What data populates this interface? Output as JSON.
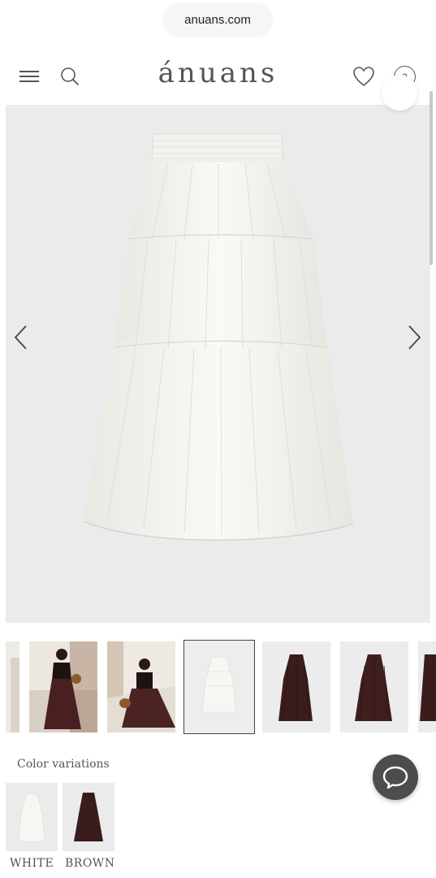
{
  "browser": {
    "url": "anuans.com"
  },
  "header": {
    "logo": "ánuans",
    "cart_count": "0",
    "menu_icon": "hamburger-icon",
    "search_icon": "search-icon",
    "wishlist_icon": "heart-icon"
  },
  "gallery": {
    "main_image": "white-tiered-skirt-photo",
    "prev_icon": "chevron-left-icon",
    "next_icon": "chevron-right-icon",
    "thumbnails": [
      {
        "image": "partial-thumbnail-photo"
      },
      {
        "image": "model-brown-skirt-photo-1"
      },
      {
        "image": "model-brown-skirt-photo-2"
      },
      {
        "image": "white-skirt-flat-photo",
        "selected": true
      },
      {
        "image": "brown-skirt-flat-photo-1"
      },
      {
        "image": "brown-skirt-flat-photo-2"
      },
      {
        "image": "partial-brown-skirt-photo"
      }
    ]
  },
  "variations": {
    "title": "Color variations",
    "items": [
      {
        "label": "WHITE",
        "color": "#f4f3ef"
      },
      {
        "label": "BROWN",
        "color": "#3b1c1c"
      }
    ]
  },
  "chat": {
    "icon": "chat-bubble-icon"
  },
  "colors": {
    "accent": "#4d4d4d",
    "image_bg": "#ebebeb",
    "skirt_white": "#f4f3ef",
    "skirt_brown": "#3b1c1c"
  }
}
